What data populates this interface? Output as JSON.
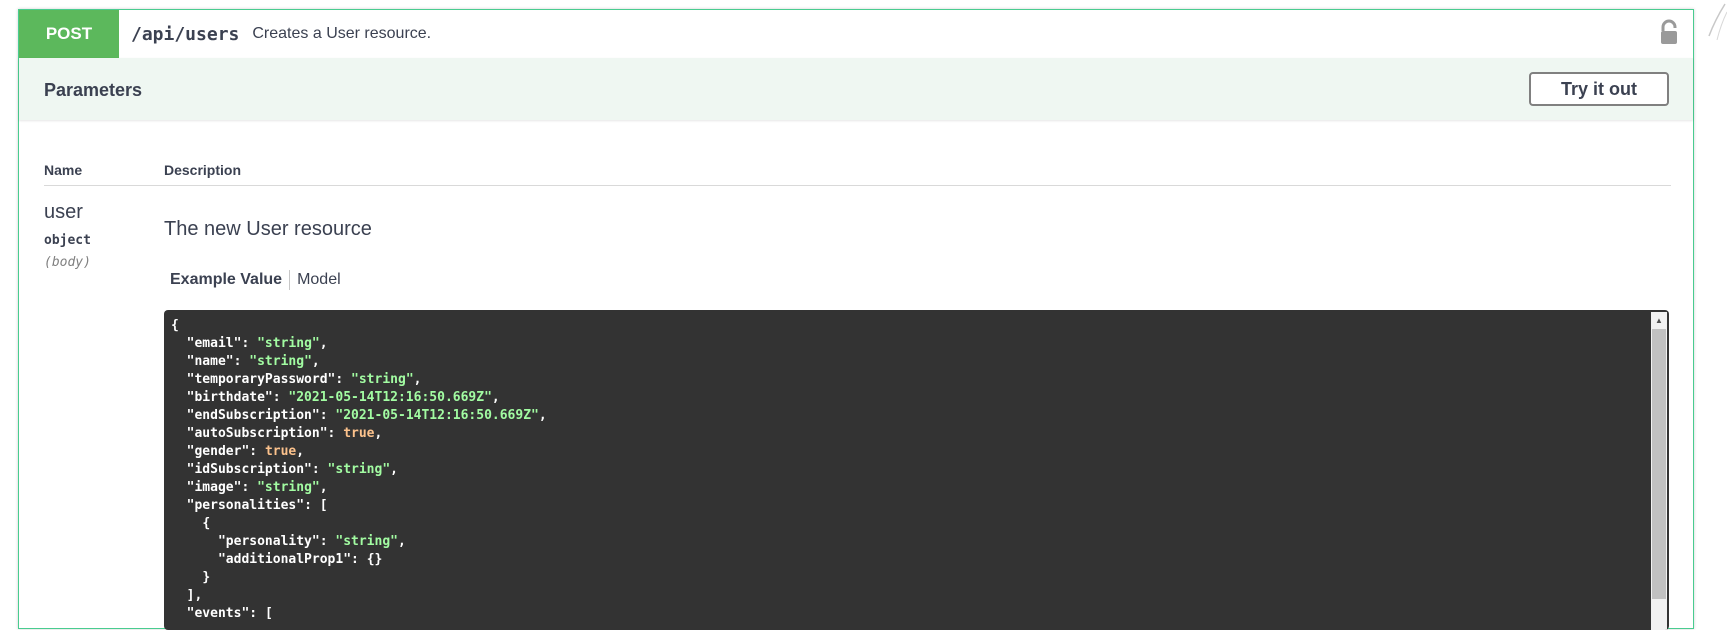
{
  "summary": {
    "method": "POST",
    "path": "/api/users",
    "description": "Creates a User resource."
  },
  "parameters": {
    "title": "Parameters",
    "try_label": "Try it out",
    "col_name": "Name",
    "col_desc": "Description"
  },
  "param": {
    "name": "user",
    "type": "object",
    "in": "(body)",
    "description": "The new User resource"
  },
  "tabs": {
    "example": "Example Value",
    "model": "Model"
  },
  "example_code": [
    {
      "indent": 0,
      "text": "{"
    },
    {
      "indent": 1,
      "key": "\"email\"",
      "val": "\"string\"",
      "vtype": "s",
      "tail": ","
    },
    {
      "indent": 1,
      "key": "\"name\"",
      "val": "\"string\"",
      "vtype": "s",
      "tail": ","
    },
    {
      "indent": 1,
      "key": "\"temporaryPassword\"",
      "val": "\"string\"",
      "vtype": "s",
      "tail": ","
    },
    {
      "indent": 1,
      "key": "\"birthdate\"",
      "val": "\"2021-05-14T12:16:50.669Z\"",
      "vtype": "s",
      "tail": ","
    },
    {
      "indent": 1,
      "key": "\"endSubscription\"",
      "val": "\"2021-05-14T12:16:50.669Z\"",
      "vtype": "s",
      "tail": ","
    },
    {
      "indent": 1,
      "key": "\"autoSubscription\"",
      "val": "true",
      "vtype": "b",
      "tail": ","
    },
    {
      "indent": 1,
      "key": "\"gender\"",
      "val": "true",
      "vtype": "b",
      "tail": ","
    },
    {
      "indent": 1,
      "key": "\"idSubscription\"",
      "val": "\"string\"",
      "vtype": "s",
      "tail": ","
    },
    {
      "indent": 1,
      "key": "\"image\"",
      "val": "\"string\"",
      "vtype": "s",
      "tail": ","
    },
    {
      "indent": 1,
      "key": "\"personalities\"",
      "val": "[",
      "vtype": "k",
      "tail": ""
    },
    {
      "indent": 2,
      "text": "{"
    },
    {
      "indent": 3,
      "key": "\"personality\"",
      "val": "\"string\"",
      "vtype": "s",
      "tail": ","
    },
    {
      "indent": 3,
      "key": "\"additionalProp1\"",
      "val": "{}",
      "vtype": "k",
      "tail": ""
    },
    {
      "indent": 2,
      "text": "}"
    },
    {
      "indent": 1,
      "text": "],"
    },
    {
      "indent": 1,
      "key": "\"events\"",
      "val": "[",
      "vtype": "k",
      "tail": ""
    }
  ],
  "colors": {
    "post_green": "#49cc90",
    "method_bg": "#5cb85c",
    "params_bg": "#eff7f2",
    "code_bg": "#333333",
    "string_color": "#a2fca2",
    "bool_color": "#fcc28c"
  }
}
